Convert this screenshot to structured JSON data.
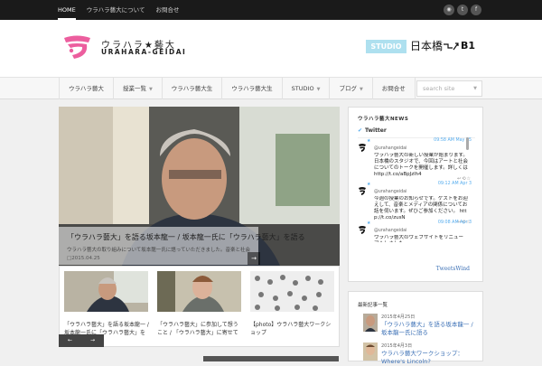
{
  "topnav": [
    {
      "label": "HOME",
      "active": true
    },
    {
      "label": "ウラハラ藝大について"
    },
    {
      "label": "お問合せ"
    }
  ],
  "social": {
    "rss": "rss-icon",
    "twitter": "twitter-icon",
    "facebook": "facebook-icon"
  },
  "header": {
    "logo_title": "ウラハラ★藝大",
    "logo_sub": "URAHARA-GEIDAI",
    "studio_badge": "STUDIO",
    "studio_location": "日本橋",
    "studio_floor": "B1"
  },
  "nav": {
    "items": [
      {
        "label": "ウラハラ藝大"
      },
      {
        "label": "授業一覧",
        "dropdown": true
      },
      {
        "label": "ウラハラ藝大生"
      },
      {
        "label": "ウラハラ藝大生"
      },
      {
        "label": "STUDIO",
        "dropdown": true
      },
      {
        "label": "ブログ",
        "dropdown": true
      },
      {
        "label": "お問合せ"
      }
    ],
    "search_placeholder": "search site"
  },
  "feature": {
    "title": "「ウラハラ藝大」を語る坂本龍一 / 坂本龍一氏に「ウラハラ藝大」を語る",
    "desc": "ウラハラ藝大の取り組みについて坂本龍一氏に語っていただきました。音楽と社会の関わりについて…",
    "date": "2015.04.25",
    "arrow": "→"
  },
  "thumbs": [
    {
      "title": "「ウラハラ藝大」を語る坂本龍一 / 坂本龍一氏に「ウラハラ藝大」を語る"
    },
    {
      "title": "「ウラハラ藝大」に参加して想うこと / 「ウラハラ藝大」に寄せて"
    },
    {
      "title": "【photo】ウラハラ藝大ワークショップ"
    }
  ],
  "pager": {
    "prev": "←",
    "next": "→"
  },
  "news": {
    "heading": "ウラハラ藝大NEWS",
    "twitter_label": "Twitter",
    "tweets": [
      {
        "time": "09:58 AM May 25",
        "user": "@urahangeidai",
        "text": "ウラハラ藝大の新しい授業が始まります。日本橋のスタジオで、今回はアートと社会についてのトークを開催します。詳しくは http://t.co/aBpJzlh4"
      },
      {
        "time": "09:12 AM Apr 3",
        "user": "@urahangeidai",
        "text": "今週の授業のお知らせです。ゲストをお迎えして、音楽とメディアの関係についてお話を伺います。ぜひご参加ください。 http://t.co/zusN"
      },
      {
        "time": "09:08 AM Apr 3",
        "user": "@urahangeidai",
        "text": "ウラハラ藝大のウェブサイトをリニューアルしました。"
      }
    ],
    "footer": "TweetsWind"
  },
  "posts": {
    "heading": "最新記事一覧",
    "items": [
      {
        "date": "2015年4月25日",
        "title": "「ウラハラ藝大」を語る坂本龍一 / 坂本龍一氏に語る"
      },
      {
        "date": "2015年4月3日",
        "title": "ウラハラ藝大ワークショップ：Where's Lincoln?"
      }
    ]
  }
}
